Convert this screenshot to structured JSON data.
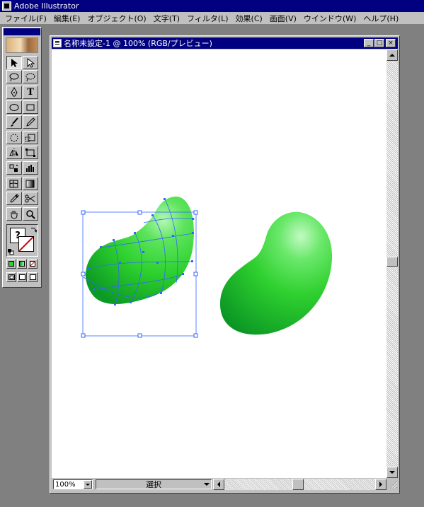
{
  "app": {
    "title": "Adobe Illustrator"
  },
  "menu": [
    "ファイル(F)",
    "編集(E)",
    "オブジェクト(O)",
    "文字(T)",
    "フィルタ(L)",
    "効果(C)",
    "画面(V)",
    "ウインドウ(W)",
    "ヘルプ(H)"
  ],
  "toolbox": {
    "text_tool_label": "T",
    "fill_stroke_label": "?"
  },
  "document": {
    "title": "名称未設定-1 @ 100% (RGB/プレビュー)",
    "minimize_label": "_",
    "maximize_label": "□",
    "close_label": "×",
    "zoom_value": "100%",
    "status_text": "選択"
  },
  "colors": {
    "bean_light": "#9bf59b",
    "bean_mid": "#2ed12e",
    "bean_dark": "#0b9a23",
    "selection": "#3366ff",
    "titlebar": "#000080"
  },
  "icons": [
    "selection-arrow-icon",
    "direct-selection-icon",
    "lasso-icon",
    "pen-icon",
    "type-icon",
    "ellipse-icon",
    "rectangle-icon",
    "paintbrush-icon",
    "pencil-icon",
    "rotate-icon",
    "scale-icon",
    "reflect-icon",
    "free-transform-icon",
    "symbol-sprayer-icon",
    "graph-icon",
    "mesh-icon",
    "gradient-icon",
    "eyedropper-icon",
    "scissors-icon",
    "hand-icon",
    "zoom-icon"
  ]
}
